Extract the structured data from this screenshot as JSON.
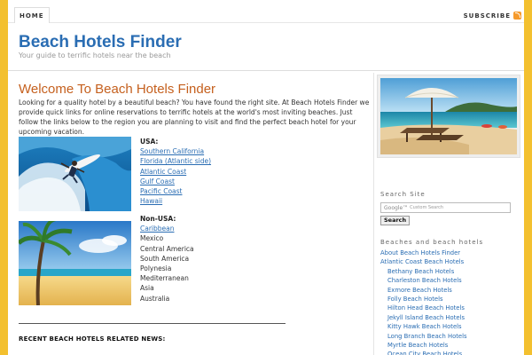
{
  "nav": {
    "home_label": "HOME",
    "subscribe_label": "SUBSCRIBE"
  },
  "header": {
    "site_title": "Beach Hotels Finder",
    "site_description": "Your guide to terrific hotels near the beach"
  },
  "main": {
    "title": "Welcome To Beach Hotels Finder",
    "intro": "Looking for a quality hotel by a beautiful beach? You have found the right site. At Beach Hotels Finder we provide quick links for online reservations to terrific hotels at the world's most inviting beaches. Just follow the links below to the region you are planning to visit and find the perfect beach hotel for your upcoming vacation.",
    "usa": {
      "heading": "USA:",
      "links": [
        "Southern California",
        "Florida (Atlantic side)",
        "Atlantic Coast",
        "Gulf Coast",
        "Pacific Coast",
        "Hawaii"
      ]
    },
    "non_usa": {
      "heading": "Non-USA:",
      "link": "Caribbean",
      "items": [
        "Mexico",
        "Central America",
        "South America",
        "Polynesia",
        "Mediterranean",
        "Asia",
        "Australia"
      ]
    },
    "news_heading": "RECENT BEACH HOTELS RELATED NEWS:"
  },
  "sidebar": {
    "search": {
      "title": "Search Site",
      "placeholder": "Custom Search",
      "google_label": "Google™",
      "button_label": "Search"
    },
    "beaches": {
      "title": "Beaches and beach hotels",
      "links": [
        {
          "label": "About Beach Hotels Finder",
          "child": false
        },
        {
          "label": "Atlantic Coast Beach Hotels",
          "child": false
        },
        {
          "label": "Bethany Beach Hotels",
          "child": true
        },
        {
          "label": "Charleston Beach Hotels",
          "child": true
        },
        {
          "label": "Exmore Beach Hotels",
          "child": true
        },
        {
          "label": "Folly Beach Hotels",
          "child": true
        },
        {
          "label": "Hilton Head Beach Hotels",
          "child": true
        },
        {
          "label": "Jekyll Island Beach Hotels",
          "child": true
        },
        {
          "label": "Kitty Hawk Beach Hotels",
          "child": true
        },
        {
          "label": "Long Branch Beach Hotels",
          "child": true
        },
        {
          "label": "Myrtle Beach Hotels",
          "child": true
        },
        {
          "label": "Ocean City Beach Hotels",
          "child": true
        }
      ]
    }
  },
  "colors": {
    "frame": "#f3c02f",
    "title_blue": "#2a6db3",
    "heading_orange": "#c5601e",
    "link_blue": "#2a6db3"
  }
}
